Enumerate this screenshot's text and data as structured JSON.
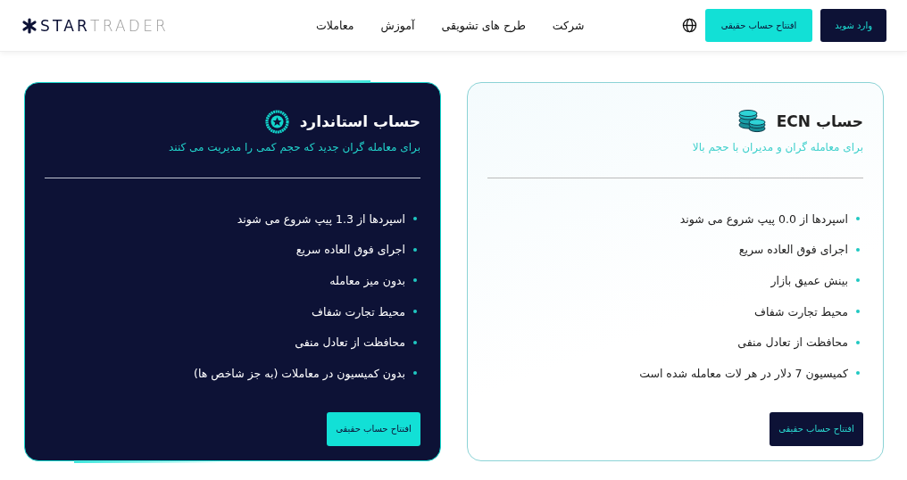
{
  "header": {
    "logo": "**STAR**TRADER",
    "nav": [
      "شرکت",
      "طرح های تشویقی",
      "آموزش",
      "معاملات"
    ],
    "buttons": [
      {
        "label": "وارد شوید",
        "kind": "dark"
      },
      {
        "label": "افتتاح حساب حقیقی",
        "kind": "accent"
      }
    ]
  },
  "cards": [
    {
      "kind": "light",
      "title": "حساب ECN",
      "subtitle": "برای معامله گران و مدیران با حجم بالا",
      "features": [
        "اسپردها از 0.0 پیپ شروع می شوند",
        "اجرای فوق العاده سریع",
        "بینش عمیق بازار",
        "محیط تجارت شفاف",
        "محافظت از تعادل منفی",
        "کمیسیون 7 دلار در هر لات معامله شده است"
      ],
      "button": "افتتاح حساب حقیقی"
    },
    {
      "kind": "dark",
      "title": "حساب استاندارد",
      "subtitle": "برای معامله گران جدید که حجم کمی را مدیریت می کنند",
      "features": [
        "اسپردها از 1.3 پیپ شروع می شوند",
        "اجرای فوق العاده سریع",
        "بدون میز معامله",
        "محیط تجارت شفاف",
        "محافظت از تعادل منفی",
        "بدون کمیسیون در معاملات (به جز شاخص ها)"
      ],
      "button": "افتتاح حساب حقیقی"
    }
  ]
}
